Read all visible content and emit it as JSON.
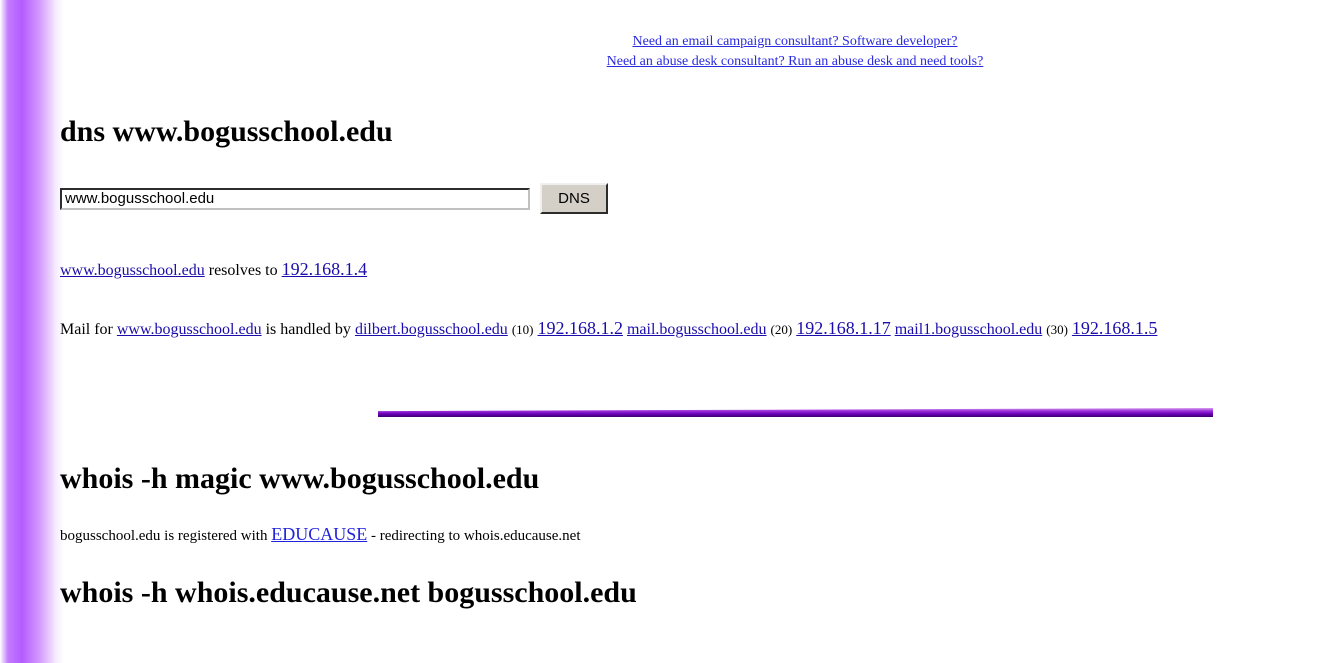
{
  "promo": {
    "line1": "Need an email campaign consultant? Software developer?",
    "line2": "Need an abuse desk consultant? Run an abuse desk and need tools?"
  },
  "dns": {
    "heading": "dns www.bogusschool.edu",
    "input_value": "www.bogusschool.edu",
    "button_label": "DNS",
    "resolves": {
      "host": "www.bogusschool.edu",
      "text": "resolves to",
      "ip": "192.168.1.4"
    },
    "mail": {
      "prefix": "Mail for",
      "host": "www.bogusschool.edu",
      "mid": "is handled by",
      "mx": [
        {
          "host": "dilbert.bogusschool.edu",
          "priority": "(10)",
          "ip": "192.168.1.2"
        },
        {
          "host": "mail.bogusschool.edu",
          "priority": "(20)",
          "ip": "192.168.1.17"
        },
        {
          "host": "mail1.bogusschool.edu",
          "priority": "(30)",
          "ip": "192.168.1.5"
        }
      ]
    }
  },
  "whois1": {
    "heading": "whois -h magic www.bogusschool.edu",
    "prefix": "bogusschool.edu is registered with",
    "registrar": "EDUCAUSE",
    "suffix": "- redirecting to whois.educause.net"
  },
  "whois2": {
    "heading": "whois -h whois.educause.net bogusschool.edu"
  },
  "colors": {
    "sidebar_gradient": "#b45cff",
    "divider": "#6a00b8",
    "link": "#1a0dab"
  }
}
